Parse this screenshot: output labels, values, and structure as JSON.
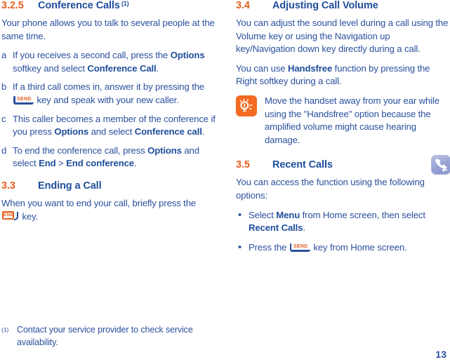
{
  "colors": {
    "section_number": "#E4601F",
    "heading_title": "#1F4E9B",
    "body_text": "#2B509E",
    "tip_icon_bg": "#F26B21",
    "recent_calls_icon_bg": "#97A1D4"
  },
  "left_column": {
    "section_325": {
      "number": "3.2.5",
      "title": "Conference Calls",
      "footnote_marker": "(1)",
      "intro": "Your phone allows you to talk to several people at the same time.",
      "steps": [
        {
          "marker": "a",
          "parts": [
            {
              "t": "If you receives a second call, press the ",
              "b": false
            },
            {
              "t": "Options",
              "b": true
            },
            {
              "t": " softkey and select ",
              "b": false
            },
            {
              "t": "Conference Call",
              "b": true
            },
            {
              "t": ".",
              "b": false
            }
          ]
        },
        {
          "marker": "b",
          "parts": [
            {
              "t": "If a third call comes in, answer it by pressing the ",
              "b": false
            },
            {
              "t": "",
              "icon": "send-key-icon"
            },
            {
              "t": " key and speak with your new caller.",
              "b": false
            }
          ]
        },
        {
          "marker": "c",
          "parts": [
            {
              "t": "This caller becomes a member of the conference if you press ",
              "b": false
            },
            {
              "t": "Options",
              "b": true
            },
            {
              "t": " and select ",
              "b": false
            },
            {
              "t": "Conference call",
              "b": true
            },
            {
              "t": ".",
              "b": false
            }
          ]
        },
        {
          "marker": "d",
          "parts": [
            {
              "t": "To end the conference call, press ",
              "b": false
            },
            {
              "t": "Options",
              "b": true
            },
            {
              "t": " and select ",
              "b": false
            },
            {
              "t": "End",
              "b": true
            },
            {
              "t": " > ",
              "b": false
            },
            {
              "t": "End conference",
              "b": true
            },
            {
              "t": ".",
              "b": false
            }
          ]
        }
      ]
    },
    "section_33": {
      "number": "3.3",
      "title": "Ending a Call",
      "text_before_key": "When you want to end your call, briefly press the ",
      "key_icon": "end-key-icon",
      "text_after_key": " key."
    },
    "footnote": {
      "marker": "(1)",
      "text": "Contact your service provider to check service availability."
    }
  },
  "right_column": {
    "section_34": {
      "number": "3.4",
      "title": "Adjusting Call Volume",
      "paragraph1": "You can adjust the sound level during a call using the Volume key or using the Navigation up key/Navigation down key directly during a call.",
      "paragraph2_parts": [
        {
          "t": "You can use ",
          "b": false
        },
        {
          "t": "Handsfree",
          "b": true
        },
        {
          "t": " function by pressing the Right softkey during a call.",
          "b": false
        }
      ],
      "tip": {
        "icon": "lightbulb-tip-icon",
        "text": "Move the handset away from your ear while using the \"Handsfree\" option because the amplified volume might cause hearing damage."
      }
    },
    "section_35": {
      "number": "3.5",
      "title": "Recent Calls",
      "icon": "recent-calls-icon",
      "intro": "You can access the function using the following options:",
      "bullets": [
        {
          "parts": [
            {
              "t": "Select ",
              "b": false
            },
            {
              "t": "Menu",
              "b": true
            },
            {
              "t": " from Home screen, then select ",
              "b": false
            },
            {
              "t": "Recent Calls",
              "b": true
            },
            {
              "t": ".",
              "b": false
            }
          ]
        },
        {
          "parts": [
            {
              "t": "Press the ",
              "b": false
            },
            {
              "t": "",
              "icon": "send-key-icon"
            },
            {
              "t": " key from Home screen.",
              "b": false
            }
          ]
        }
      ]
    }
  },
  "page_number": "13"
}
